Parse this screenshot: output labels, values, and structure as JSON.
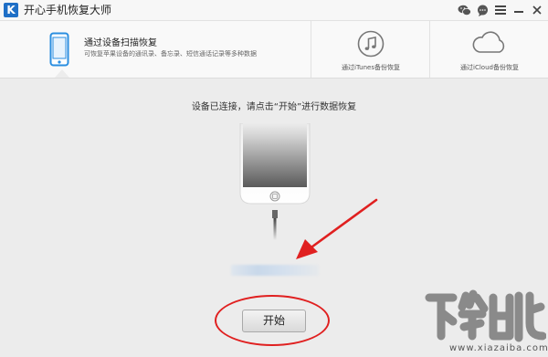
{
  "app": {
    "logo_letter": "K",
    "title": "开心手机恢复大师"
  },
  "titlebar_icons": [
    "wechat-icon",
    "chat-icon",
    "menu-icon",
    "minimize-icon",
    "close-icon"
  ],
  "tabs": {
    "scan": {
      "title": "通过设备扫描恢复",
      "description": "可恢复苹果设备的通讯录、备忘录、短信通话记录等多种数据",
      "icon": "phone-icon",
      "active": true
    },
    "itunes": {
      "label": "通过iTunes备份恢复",
      "icon": "music-note-icon"
    },
    "icloud": {
      "label": "通过iCloud备份恢复",
      "icon": "cloud-icon"
    }
  },
  "main": {
    "instruction": "设备已连接，请点击“开始”进行数据恢复",
    "start_button_label": "开始"
  },
  "colors": {
    "accent_blue": "#1f6fc6",
    "annotation_red": "#e02020",
    "background": "#ececec"
  },
  "watermark": {
    "text": "www.xiazaiba.com"
  }
}
